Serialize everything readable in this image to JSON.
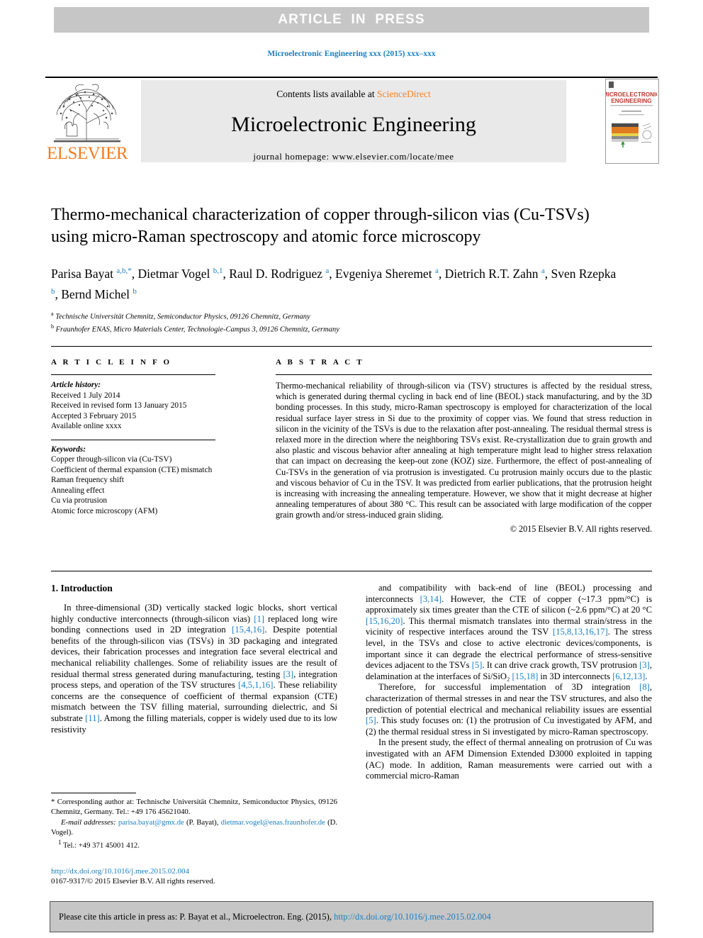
{
  "banner": {
    "text": "ARTICLE  IN  PRESS"
  },
  "journal_line": "Microelectronic Engineering xxx (2015) xxx–xxx",
  "masthead": {
    "contents_prefix": "Contents lists available at ",
    "sciencedirect": "ScienceDirect",
    "journal_name": "Microelectronic Engineering",
    "homepage": "journal homepage: www.elsevier.com/locate/mee",
    "publisher": "ELSEVIER",
    "cover_title_line1": "MICROELECTRONIC",
    "cover_title_line2": "ENGINEERING"
  },
  "article": {
    "title": "Thermo-mechanical characterization of copper through-silicon vias (Cu-TSVs) using micro-Raman spectroscopy and atomic force microscopy",
    "authors_html": "Parisa Bayat <sup>a,b,*</sup>, Dietmar Vogel <sup>b,1</sup>, Raul D. Rodriguez <sup>a</sup>, Evgeniya Sheremet <sup>a</sup>, Dietrich R.T. Zahn <sup>a</sup>, Sven Rzepka <sup>b</sup>, Bernd Michel <sup>b</sup>",
    "affiliation_a": "Technische Universität Chemnitz, Semiconductor Physics, 09126 Chemnitz, Germany",
    "affiliation_b": "Fraunhofer ENAS, Micro Materials Center, Technologie-Campus 3, 09126 Chemnitz, Germany"
  },
  "info": {
    "heading": "A R T I C L E   I N F O",
    "history_title": "Article history:",
    "history": [
      "Received 1 July 2014",
      "Received in revised form 13 January 2015",
      "Accepted 3 February 2015",
      "Available online xxxx"
    ],
    "keywords_title": "Keywords:",
    "keywords": [
      "Copper through-silicon via (Cu-TSV)",
      "Coefficient of thermal expansion (CTE) mismatch",
      "Raman frequency shift",
      "Annealing effect",
      "Cu via protrusion",
      "Atomic force microscopy (AFM)"
    ]
  },
  "abstract": {
    "heading": "A B S T R A C T",
    "text": "Thermo-mechanical reliability of through-silicon via (TSV) structures is affected by the residual stress, which is generated during thermal cycling in back end of line (BEOL) stack manufacturing, and by the 3D bonding processes. In this study, micro-Raman spectroscopy is employed for characterization of the local residual surface layer stress in Si due to the proximity of copper vias. We found that stress reduction in silicon in the vicinity of the TSVs is due to the relaxation after post-annealing. The residual thermal stress is relaxed more in the direction where the neighboring TSVs exist. Re-crystallization due to grain growth and also plastic and viscous behavior after annealing at high temperature might lead to higher stress relaxation that can impact on decreasing the keep-out zone (KOZ) size. Furthermore, the effect of post-annealing of Cu-TSVs in the generation of via protrusion is investigated. Cu protrusion mainly occurs due to the plastic and viscous behavior of Cu in the TSV. It was predicted from earlier publications, that the protrusion height is increasing with increasing the annealing temperature. However, we show that it might decrease at higher annealing temperatures of about 380 °C. This result can be associated with large modification of the copper grain growth and/or stress-induced grain sliding.",
    "copyright": "© 2015 Elsevier B.V. All rights reserved."
  },
  "body": {
    "section_title": "1. Introduction",
    "left_paragraphs": [
      "In three-dimensional (3D) vertically stacked logic blocks, short vertical highly conductive interconnects (through-silicon vias) [1] replaced long wire bonding connections used in 2D integration [15,4,16]. Despite potential benefits of the through-silicon vias (TSVs) in 3D packaging and integrated devices, their fabrication processes and integration face several electrical and mechanical reliability challenges. Some of reliability issues are the result of residual thermal stress generated during manufacturing, testing [3], integration process steps, and operation of the TSV structures [4,5,1,16]. These reliability concerns are the consequence of coefficient of thermal expansion (CTE) mismatch between the TSV filling material, surrounding dielectric, and Si substrate [11]. Among the filling materials, copper is widely used due to its low resistivity"
    ],
    "right_paragraphs": [
      "and compatibility with back-end of line (BEOL) processing and interconnects [3,14]. However, the CTE of copper (~17.3 ppm/°C) is approximately six times greater than the CTE of silicon (~2.6 ppm/°C) at 20 °C [15,16,20]. This thermal mismatch translates into thermal strain/stress in the vicinity of respective interfaces around the TSV [15,8,13,16,17]. The stress level, in the TSVs and close to active electronic devices/components, is important since it can degrade the electrical performance of stress-sensitive devices adjacent to the TSVs [5]. It can drive crack growth, TSV protrusion [3], delamination at the interfaces of Si/SiO₂ [15,18] in 3D interconnects [6,12,13].",
      "Therefore, for successful implementation of 3D integration [8], characterization of thermal stresses in and near the TSV structures, and also the prediction of potential electrical and mechanical reliability issues are essential [5]. This study focuses on: (1) the protrusion of Cu investigated by AFM, and (2) the thermal residual stress in Si investigated by micro-Raman spectroscopy.",
      "In the present study, the effect of thermal annealing on protrusion of Cu was investigated with an AFM Dimension Extended D3000 exploited in tapping (AC) mode. In addition, Raman measurements were carried out with a commercial micro-Raman"
    ]
  },
  "footnotes": {
    "corresponding": "* Corresponding author at: Technische Universität Chemnitz, Semiconductor Physics, 09126 Chemnitz, Germany. Tel.: +49 176 45621040.",
    "email_label": "E-mail addresses:",
    "email1": "parisa.bayat@gmx.de",
    "email1_who": "(P. Bayat),",
    "email2": "dietmar.vogel@enas.fraunhofer.de",
    "email2_who": "(D. Vogel).",
    "tel_sup": "1",
    "tel": "Tel.: +49 371 45001 412.",
    "doi": "http://dx.doi.org/10.1016/j.mee.2015.02.004",
    "issn": "0167-9317/© 2015 Elsevier B.V. All rights reserved."
  },
  "footer": {
    "cite_text": "Please cite this article in press as: P. Bayat et al., Microelectron. Eng. (2015), ",
    "cite_link": "http://dx.doi.org/10.1016/j.mee.2015.02.004"
  },
  "colors": {
    "link_blue": "#1a7fc1",
    "elsevier_orange": "#f47c20",
    "banner_gray": "#c6c6c6",
    "masthead_gray": "#e9e9e9"
  }
}
